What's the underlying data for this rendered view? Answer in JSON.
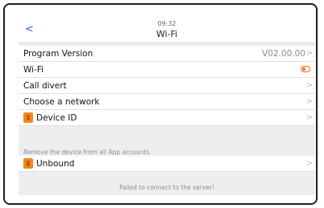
{
  "header": {
    "back_label": "<",
    "time": "09:32",
    "title": "Wi-Fi"
  },
  "rows": [
    {
      "label": "Program Version",
      "value": "V02.00.00"
    },
    {
      "label": "Wi-Fi",
      "toggle_color": "#ff6a1a"
    },
    {
      "label": "Call divert"
    },
    {
      "label": "Choose a network"
    },
    {
      "label": "Device ID",
      "icon": "device-id-icon",
      "icon_color": "#f08a1c"
    }
  ],
  "unbound_section": {
    "note": "Remove the device from all App accounts.",
    "label": "Unbound",
    "icon": "unbound-icon",
    "icon_color": "#f08a1c"
  },
  "status_message": "Failed to connect to the server!",
  "chevron": ">"
}
